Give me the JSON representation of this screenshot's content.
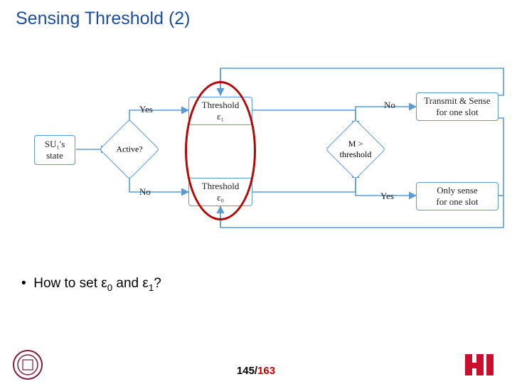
{
  "title": "Sensing Threshold (2)",
  "nodes": {
    "su_state": "SU₁'s\nstate",
    "active": "Active?",
    "th1": "Threshold\nε₁",
    "th0": "Threshold\nε₀",
    "cmp": "M >\nthreshold",
    "tx": "Transmit & Sense\nfor one slot",
    "rx": "Only sense\nfor one slot"
  },
  "edges": {
    "yes1": "Yes",
    "no1": "No",
    "yes2": "Yes",
    "no2": "No"
  },
  "bullet": {
    "lead": "How to set ε",
    "s0": "0",
    "mid": " and ε",
    "s1": "1",
    "tail": "?"
  },
  "page": {
    "current": "145",
    "total": "163"
  },
  "logos": {
    "left": "tsinghua-seal",
    "right": "uh-logo"
  }
}
